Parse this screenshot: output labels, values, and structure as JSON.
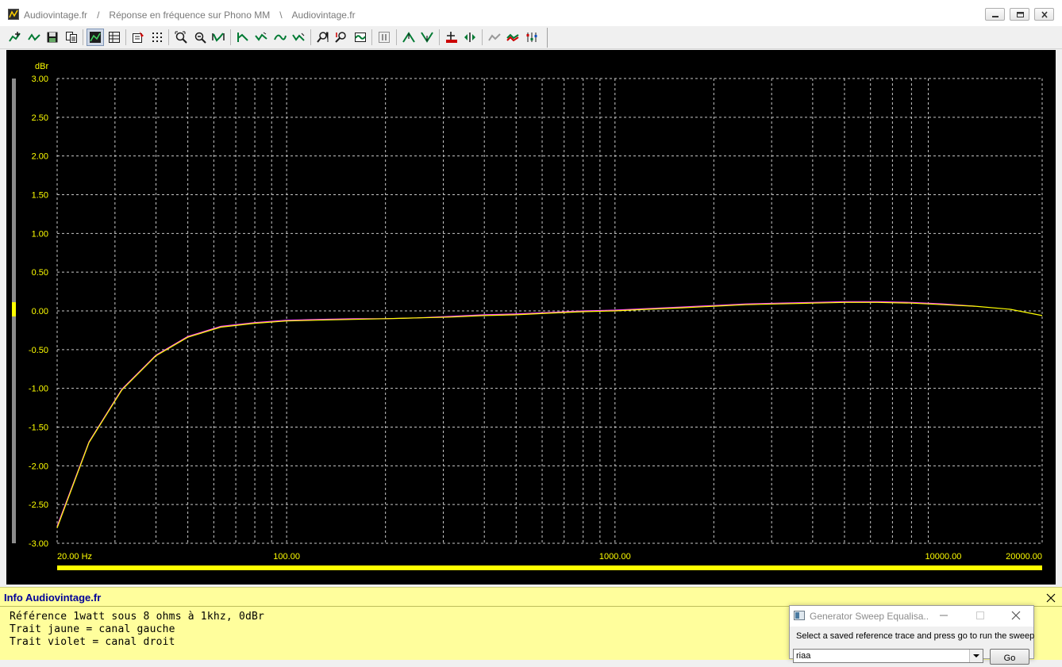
{
  "window": {
    "title_parts": [
      "Audiovintage.fr",
      "/",
      "Réponse en fréquence sur Phono MM",
      "\\",
      "Audiovintage.fr"
    ]
  },
  "toolbar": {
    "groups": [
      [
        "add-trace-icon",
        "trace-shape-icon",
        "save-icon",
        "copy-icon"
      ],
      [
        "graph-view-icon",
        "properties-grid-icon"
      ],
      [
        "edit-icon",
        "dotted-grid-icon"
      ],
      [
        "zoom-fit-icon",
        "zoom-out-icon",
        "waveform-icon"
      ],
      [
        "curve-up-icon",
        "curve-down-icon",
        "curve-sweep-icon",
        "curve-check-icon"
      ],
      [
        "zoom-x-icon",
        "zoom-y-icon",
        "trace-wave-icon"
      ],
      [
        "pause-icon"
      ],
      [
        "peak-up-icon",
        "peak-down-icon"
      ],
      [
        "marker-add-icon",
        "marker-move-icon"
      ],
      [
        "hide-trace-icon",
        "compare-trace-icon",
        "settings-trace-icon"
      ]
    ]
  },
  "chart_data": {
    "type": "line",
    "title": "",
    "xlabel": "",
    "ylabel": "dBr",
    "x_scale": "log",
    "xlim": [
      20,
      20000
    ],
    "ylim": [
      -3.0,
      3.0
    ],
    "grid": true,
    "y_tick_labels": [
      "3.00",
      "2.50",
      "2.00",
      "1.50",
      "1.00",
      "0.50",
      "0.00",
      "-0.50",
      "-1.00",
      "-1.50",
      "-2.00",
      "-2.50",
      "-3.00"
    ],
    "x_tick_labels": [
      {
        "value": 20,
        "label": "20.00 Hz"
      },
      {
        "value": 100,
        "label": "100.00"
      },
      {
        "value": 1000,
        "label": "1000.00"
      },
      {
        "value": 10000,
        "label": "10000.00"
      },
      {
        "value": 20000,
        "label": "20000.00"
      }
    ],
    "series": [
      {
        "color": "#ffff00",
        "x": [
          20,
          25,
          31.5,
          40,
          50,
          63,
          80,
          100,
          125,
          160,
          200,
          250,
          315,
          400,
          500,
          630,
          800,
          1000,
          1250,
          1600,
          2000,
          2500,
          3150,
          4000,
          5000,
          6300,
          8000,
          10000,
          12500,
          16000,
          20000
        ],
        "y": [
          -2.8,
          -1.7,
          -1.02,
          -0.58,
          -0.34,
          -0.21,
          -0.16,
          -0.13,
          -0.12,
          -0.11,
          -0.1,
          -0.09,
          -0.08,
          -0.06,
          -0.05,
          -0.03,
          -0.01,
          0.0,
          0.02,
          0.04,
          0.06,
          0.08,
          0.09,
          0.1,
          0.11,
          0.11,
          0.1,
          0.08,
          0.06,
          0.02,
          -0.06
        ]
      },
      {
        "color": "#ff44ff",
        "x": [
          20,
          25,
          31.5,
          40,
          50,
          63,
          80,
          100,
          125,
          160,
          200,
          250,
          315,
          400,
          500,
          630,
          800,
          1000,
          1250,
          1600,
          2000,
          2500,
          3150,
          4000,
          5000,
          6300,
          8000,
          10000,
          12500
        ],
        "y": [
          -2.78,
          -1.69,
          -1.01,
          -0.57,
          -0.33,
          -0.2,
          -0.15,
          -0.12,
          -0.11,
          -0.1,
          -0.1,
          -0.09,
          -0.07,
          -0.05,
          -0.04,
          -0.02,
          0.0,
          0.01,
          0.03,
          0.05,
          0.07,
          0.09,
          0.1,
          0.11,
          0.12,
          0.12,
          0.11,
          0.09,
          0.06
        ]
      }
    ]
  },
  "info": {
    "title": "Info Audiovintage.fr",
    "lines": [
      "Référence 1watt sous 8 ohms à 1khz, 0dBr",
      "Trait jaune = canal gauche",
      "Trait violet = canal droit"
    ]
  },
  "dialog": {
    "title": "Generator Sweep Equalisa...",
    "message": "Select a saved reference trace and press go to run the sweep",
    "select_value": "riaa",
    "go_label": "Go"
  }
}
